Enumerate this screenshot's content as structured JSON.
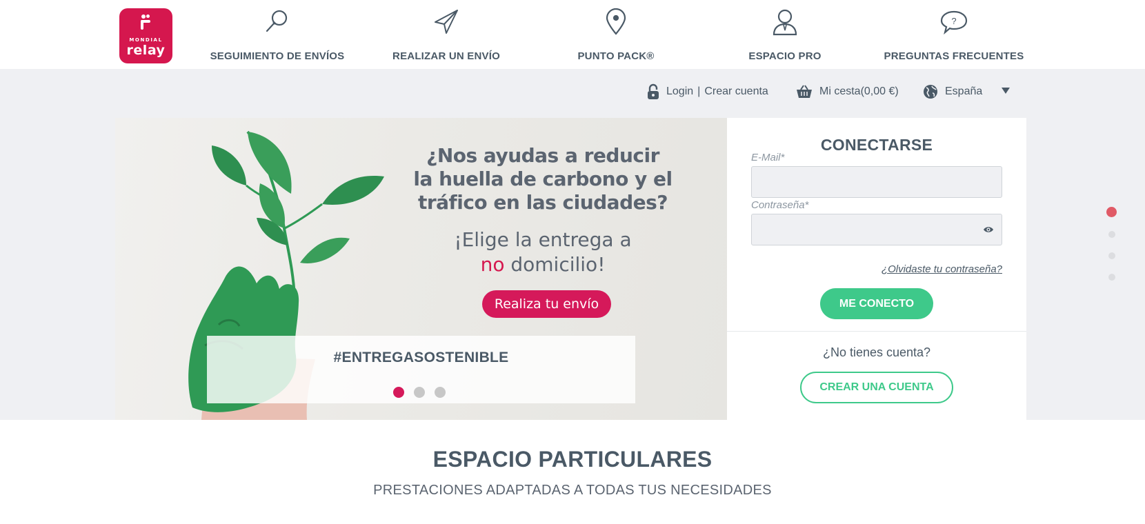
{
  "brand": {
    "logo_small": "MONDIAL",
    "logo_big": "relay",
    "accent": "#d5174e",
    "green": "#3ec98a"
  },
  "nav": {
    "items": [
      {
        "label": "SEGUIMIENTO DE ENVÍOS",
        "icon": "search-icon"
      },
      {
        "label": "REALIZAR UN ENVÍO",
        "icon": "paper-plane-icon"
      },
      {
        "label": "PUNTO PACK®",
        "icon": "map-pin-icon"
      },
      {
        "label": "ESPACIO PRO",
        "icon": "user-icon"
      },
      {
        "label": "PREGUNTAS FRECUENTES",
        "icon": "question-bubble-icon"
      }
    ]
  },
  "utility": {
    "login": "Login",
    "separator": "|",
    "create": "Crear cuenta",
    "cart": "Mi cesta(0,00 €)",
    "country": "España"
  },
  "hero": {
    "title_line1": "¿Nos ayudas a reducir",
    "title_line2": "la huella de carbono y el",
    "title_line3": "tráfico en las ciudades?",
    "sub_line1": "¡Elige la entrega a",
    "sub_no": "no",
    "sub_line2_rest": " domicilio!",
    "button": "Realiza tu envío",
    "hashtag": "#ENTREGASOSTENIBLE",
    "slides": 3,
    "active_slide": 1
  },
  "login_panel": {
    "title": "CONECTARSE",
    "email_label": "E-Mail*",
    "email_value": "",
    "password_label": "Contraseña*",
    "password_value": "",
    "forgot": "¿Olvidaste tu contraseña?",
    "submit": "ME CONECTO",
    "no_account": "¿No tienes cuenta?",
    "create_account": "CREAR UNA CUENTA"
  },
  "page_sections": {
    "count": 4,
    "active": 1
  },
  "section": {
    "title": "ESPACIO PARTICULARES",
    "subtitle": "PRESTACIONES ADAPTADAS A TODAS TUS NECESIDADES"
  }
}
